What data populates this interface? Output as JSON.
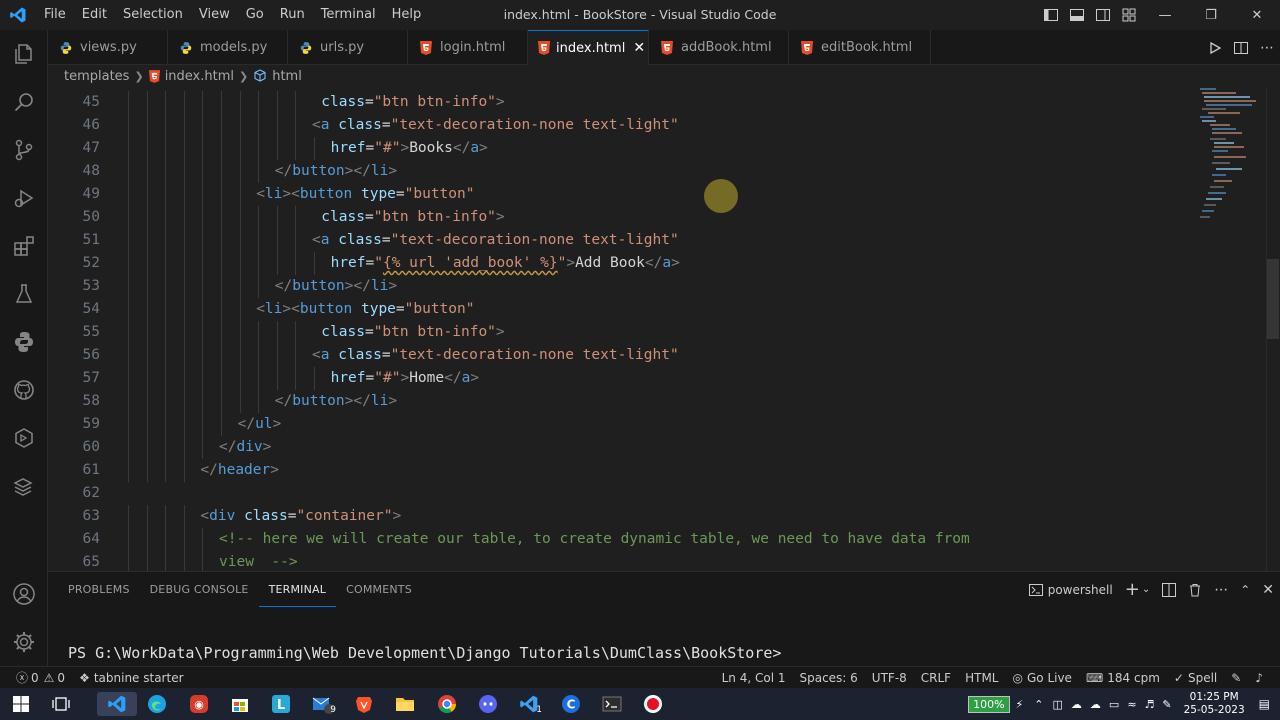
{
  "window": {
    "title": "index.html - BookStore - Visual Studio Code"
  },
  "menu": [
    "File",
    "Edit",
    "Selection",
    "View",
    "Go",
    "Run",
    "Terminal",
    "Help"
  ],
  "tabs": [
    {
      "label": "views.py",
      "type": "python",
      "active": false
    },
    {
      "label": "models.py",
      "type": "python",
      "active": false
    },
    {
      "label": "urls.py",
      "type": "python",
      "active": false
    },
    {
      "label": "login.html",
      "type": "html",
      "active": false
    },
    {
      "label": "index.html",
      "type": "html",
      "active": true
    },
    {
      "label": "addBook.html",
      "type": "html",
      "active": false
    },
    {
      "label": "editBook.html",
      "type": "html",
      "active": false
    }
  ],
  "breadcrumb": {
    "folder": "templates",
    "file": "index.html",
    "symbol": "html"
  },
  "editor": {
    "lines": [
      {
        "n": "45",
        "indent": 21,
        "parts": [
          [
            "at",
            "class"
          ],
          [
            "tx",
            "="
          ],
          [
            "st",
            "\"btn btn-info\""
          ],
          [
            "tg",
            ">"
          ]
        ]
      },
      {
        "n": "46",
        "indent": 20,
        "parts": [
          [
            "tg",
            "<"
          ],
          [
            "tn",
            "a"
          ],
          [
            "tx",
            " "
          ],
          [
            "at",
            "class"
          ],
          [
            "tx",
            "="
          ],
          [
            "st",
            "\"text-decoration-none text-light\""
          ]
        ]
      },
      {
        "n": "47",
        "indent": 22,
        "parts": [
          [
            "at",
            "href"
          ],
          [
            "tx",
            "="
          ],
          [
            "st",
            "\"#\""
          ],
          [
            "tg",
            ">"
          ],
          [
            "tx",
            "Books"
          ],
          [
            "tg",
            "</"
          ],
          [
            "tn",
            "a"
          ],
          [
            "tg",
            ">"
          ]
        ]
      },
      {
        "n": "48",
        "indent": 16,
        "parts": [
          [
            "tg",
            "</"
          ],
          [
            "tn",
            "button"
          ],
          [
            "tg",
            "></"
          ],
          [
            "tn",
            "li"
          ],
          [
            "tg",
            ">"
          ]
        ]
      },
      {
        "n": "49",
        "indent": 14,
        "parts": [
          [
            "tg",
            "<"
          ],
          [
            "tn",
            "li"
          ],
          [
            "tg",
            "><"
          ],
          [
            "tn",
            "button"
          ],
          [
            "tx",
            " "
          ],
          [
            "at",
            "type"
          ],
          [
            "tx",
            "="
          ],
          [
            "st",
            "\"button\""
          ]
        ]
      },
      {
        "n": "50",
        "indent": 21,
        "parts": [
          [
            "at",
            "class"
          ],
          [
            "tx",
            "="
          ],
          [
            "st",
            "\"btn btn-info\""
          ],
          [
            "tg",
            ">"
          ]
        ]
      },
      {
        "n": "51",
        "indent": 20,
        "parts": [
          [
            "tg",
            "<"
          ],
          [
            "tn",
            "a"
          ],
          [
            "tx",
            " "
          ],
          [
            "at",
            "class"
          ],
          [
            "tx",
            "="
          ],
          [
            "st",
            "\"text-decoration-none text-light\""
          ]
        ]
      },
      {
        "n": "52",
        "indent": 22,
        "parts": [
          [
            "at",
            "href"
          ],
          [
            "tx",
            "="
          ],
          [
            "st",
            "\""
          ],
          [
            "dj",
            "{% url 'add_book' %}"
          ],
          [
            "st",
            "\""
          ],
          [
            "tg",
            ">"
          ],
          [
            "tx",
            "Add Book"
          ],
          [
            "tg",
            "</"
          ],
          [
            "tn",
            "a"
          ],
          [
            "tg",
            ">"
          ]
        ]
      },
      {
        "n": "53",
        "indent": 16,
        "parts": [
          [
            "tg",
            "</"
          ],
          [
            "tn",
            "button"
          ],
          [
            "tg",
            "></"
          ],
          [
            "tn",
            "li"
          ],
          [
            "tg",
            ">"
          ]
        ]
      },
      {
        "n": "54",
        "indent": 14,
        "parts": [
          [
            "tg",
            "<"
          ],
          [
            "tn",
            "li"
          ],
          [
            "tg",
            "><"
          ],
          [
            "tn",
            "button"
          ],
          [
            "tx",
            " "
          ],
          [
            "at",
            "type"
          ],
          [
            "tx",
            "="
          ],
          [
            "st",
            "\"button\""
          ]
        ]
      },
      {
        "n": "55",
        "indent": 21,
        "parts": [
          [
            "at",
            "class"
          ],
          [
            "tx",
            "="
          ],
          [
            "st",
            "\"btn btn-info\""
          ],
          [
            "tg",
            ">"
          ]
        ]
      },
      {
        "n": "56",
        "indent": 20,
        "parts": [
          [
            "tg",
            "<"
          ],
          [
            "tn",
            "a"
          ],
          [
            "tx",
            " "
          ],
          [
            "at",
            "class"
          ],
          [
            "tx",
            "="
          ],
          [
            "st",
            "\"text-decoration-none text-light\""
          ]
        ]
      },
      {
        "n": "57",
        "indent": 22,
        "parts": [
          [
            "at",
            "href"
          ],
          [
            "tx",
            "="
          ],
          [
            "st",
            "\"#\""
          ],
          [
            "tg",
            ">"
          ],
          [
            "tx",
            "Home"
          ],
          [
            "tg",
            "</"
          ],
          [
            "tn",
            "a"
          ],
          [
            "tg",
            ">"
          ]
        ]
      },
      {
        "n": "58",
        "indent": 16,
        "parts": [
          [
            "tg",
            "</"
          ],
          [
            "tn",
            "button"
          ],
          [
            "tg",
            "></"
          ],
          [
            "tn",
            "li"
          ],
          [
            "tg",
            ">"
          ]
        ]
      },
      {
        "n": "59",
        "indent": 12,
        "parts": [
          [
            "tg",
            "</"
          ],
          [
            "tn",
            "ul"
          ],
          [
            "tg",
            ">"
          ]
        ]
      },
      {
        "n": "60",
        "indent": 10,
        "parts": [
          [
            "tg",
            "</"
          ],
          [
            "tn",
            "div"
          ],
          [
            "tg",
            ">"
          ]
        ]
      },
      {
        "n": "61",
        "indent": 8,
        "parts": [
          [
            "tg",
            "</"
          ],
          [
            "tn",
            "header"
          ],
          [
            "tg",
            ">"
          ]
        ]
      },
      {
        "n": "62",
        "indent": 0,
        "parts": []
      },
      {
        "n": "63",
        "indent": 8,
        "parts": [
          [
            "tg",
            "<"
          ],
          [
            "tn",
            "div"
          ],
          [
            "tx",
            " "
          ],
          [
            "at",
            "class"
          ],
          [
            "tx",
            "="
          ],
          [
            "st",
            "\"container\""
          ],
          [
            "tg",
            ">"
          ]
        ]
      },
      {
        "n": "64",
        "indent": 10,
        "parts": [
          [
            "cm",
            "<!-- here we will create our table, to create dynamic table, we need to have data from"
          ]
        ]
      },
      {
        "n": "65",
        "indent": 10,
        "parts": [
          [
            "cm",
            "view  -->"
          ]
        ]
      }
    ]
  },
  "panel": {
    "tabs": [
      {
        "label": "PROBLEMS",
        "active": false
      },
      {
        "label": "DEBUG CONSOLE",
        "active": false
      },
      {
        "label": "TERMINAL",
        "active": true
      },
      {
        "label": "COMMENTS",
        "active": false
      }
    ],
    "shell": "powershell",
    "prompt": "PS G:\\WorkData\\Programming\\Web Development\\Django Tutorials\\DumClass\\BookStore>"
  },
  "status": {
    "errors": "0",
    "warnings": "0",
    "tabnine": "tabnine starter",
    "position": "Ln 4, Col 1",
    "spaces": "Spaces: 6",
    "encoding": "UTF-8",
    "eol": "CRLF",
    "language": "HTML",
    "golive": "Go Live",
    "cpm": "184 cpm",
    "spell": "Spell"
  },
  "taskbar": {
    "battery": "100%",
    "time": "01:25 PM",
    "date": "25-05-2023",
    "mail_badge": "9",
    "vscode_badge": "1"
  },
  "colors": {
    "accent": "#0078d4",
    "html_icon": "#e44d26",
    "python_icon": "#4b8bbe"
  }
}
